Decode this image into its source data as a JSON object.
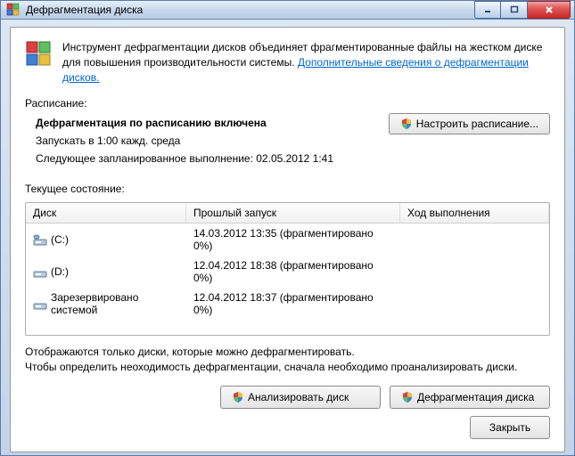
{
  "window": {
    "title": "Дефрагментация диска"
  },
  "info": {
    "text_a": "Инструмент дефрагментации дисков объединяет фрагментированные файлы на жестком диске для повышения производительности системы. ",
    "link": "Дополнительные сведения о дефрагментации дисков."
  },
  "schedule": {
    "label": "Расписание:",
    "title": "Дефрагментация по расписанию включена",
    "run_at": "Запускать в 1:00 кажд. среда",
    "next_run": "Следующее запланированное выполнение: 02.05.2012 1:41",
    "configure_btn": "Настроить расписание..."
  },
  "state_label": "Текущее состояние:",
  "table": {
    "headers": {
      "disk": "Диск",
      "last_run": "Прошлый запуск",
      "progress": "Ход выполнения"
    },
    "rows": [
      {
        "name": "(C:)",
        "last_run": "14.03.2012 13:35 (фрагментировано 0%)",
        "progress": ""
      },
      {
        "name": "(D:)",
        "last_run": "12.04.2012 18:38 (фрагментировано 0%)",
        "progress": ""
      },
      {
        "name": "Зарезервировано системой",
        "last_run": "12.04.2012 18:37 (фрагментировано 0%)",
        "progress": ""
      }
    ]
  },
  "note": {
    "line1": "Отображаются только диски, которые можно дефрагментировать.",
    "line2": "Чтобы определить неоходимость  дефрагментации, сначала необходимо проанализировать диски."
  },
  "actions": {
    "analyze": "Анализировать диск",
    "defrag": "Дефрагментация диска",
    "close": "Закрыть"
  }
}
